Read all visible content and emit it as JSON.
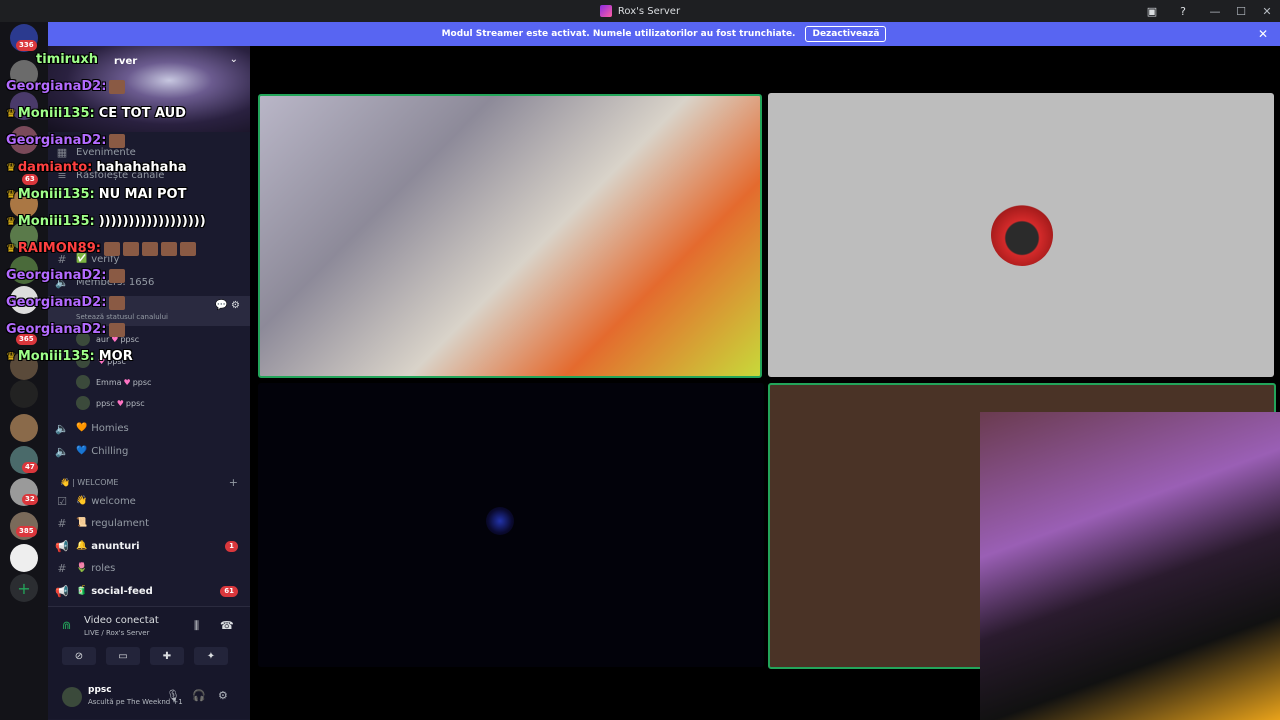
{
  "window": {
    "title": "Rox's Server",
    "controls": [
      "—",
      "☐",
      "✕"
    ]
  },
  "banner": {
    "text": "Modul Streamer este activat. Numele utilizatorilor au fost trunchiate.",
    "button": "Dezactivează",
    "close": "✕"
  },
  "rail": {
    "badges": [
      "336",
      "63",
      "365",
      "47",
      "32",
      "385"
    ],
    "add": "+"
  },
  "sidebar": {
    "server_name": "rver",
    "items": {
      "events": "Evenimente",
      "browse": "Răsfoiește canale",
      "verify": "verify",
      "members": "Members: 1656",
      "status": "Setează statusul canalului"
    },
    "voice_users": [
      {
        "name": "aur",
        "tag": "ppsc"
      },
      {
        "name": "",
        "tag": "ppsc"
      },
      {
        "name": "Emma",
        "tag": "ppsc"
      },
      {
        "name": "ppsc",
        "tag": "ppsc"
      }
    ],
    "voice_channels": [
      {
        "name": "Homies",
        "emoji": "🧡"
      },
      {
        "name": "Chilling",
        "emoji": "💙"
      }
    ],
    "category": "| WELCOME",
    "channels": [
      {
        "name": "welcome",
        "emoji": "👋",
        "bold": false,
        "unread": ""
      },
      {
        "name": "regulament",
        "emoji": "📜",
        "bold": false,
        "unread": ""
      },
      {
        "name": "anunturi",
        "emoji": "🔔",
        "bold": true,
        "unread": "1"
      },
      {
        "name": "roles",
        "emoji": "🌷",
        "bold": false,
        "unread": ""
      },
      {
        "name": "social-feed",
        "emoji": "🧃",
        "bold": true,
        "unread": "61"
      }
    ]
  },
  "voice_panel": {
    "status": "Video conectat",
    "location": "LIVE / Rox's Server"
  },
  "user_panel": {
    "name": "ppsc",
    "status": "Ascultă pe The Weeknd +1"
  },
  "chat": [
    {
      "user": "timiruxh",
      "text": "",
      "color": "green",
      "crown": false
    },
    {
      "user": "GeorgianaD2:",
      "text": "",
      "color": "purple",
      "crown": false
    },
    {
      "user": "Moniii135:",
      "text": "CE TOT AUD",
      "color": "green",
      "crown": true
    },
    {
      "user": "GeorgianaD2:",
      "text": "",
      "color": "purple",
      "crown": false
    },
    {
      "user": "damianto:",
      "text": "hahahahaha",
      "color": "red",
      "crown": true
    },
    {
      "user": "Moniii135:",
      "text": "NU MAI POT",
      "color": "green",
      "crown": true
    },
    {
      "user": "Moniii135:",
      "text": "))))))))))))))))))",
      "color": "green",
      "crown": true
    },
    {
      "user": "RAIMON89:",
      "text": "",
      "color": "red",
      "crown": true
    },
    {
      "user": "GeorgianaD2:",
      "text": "",
      "color": "purple",
      "crown": false
    },
    {
      "user": "GeorgianaD2:",
      "text": "",
      "color": "purple",
      "crown": false
    },
    {
      "user": "GeorgianaD2:",
      "text": "",
      "color": "purple",
      "crown": false
    },
    {
      "user": "Moniii135:",
      "text": "MOR",
      "color": "green",
      "crown": true
    }
  ]
}
